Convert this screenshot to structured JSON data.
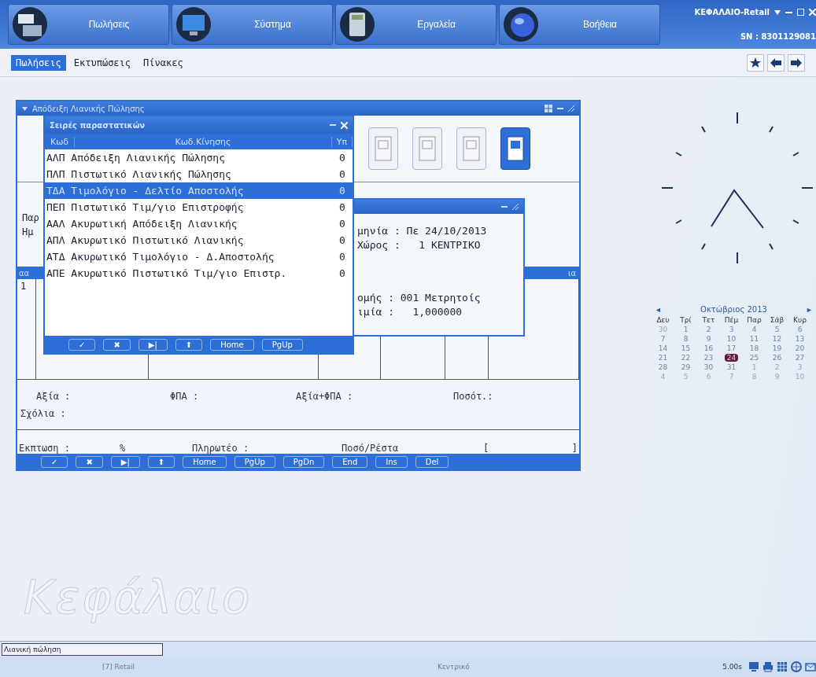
{
  "app_bar": {
    "modules": [
      {
        "label": "Πωλήσεις"
      },
      {
        "label": "Σύστημα"
      },
      {
        "label": "Εργαλεία"
      },
      {
        "label": "Βοήθεια"
      }
    ],
    "title": "ΚΕΦΑΛΑΙΟ-Retail",
    "serial": "SN : 8301129081"
  },
  "menu": [
    {
      "label": "Πωλήσεις",
      "selected": true
    },
    {
      "label": "Εκτυπώσεις",
      "selected": false
    },
    {
      "label": "Πίνακες",
      "selected": false
    }
  ],
  "main_window": {
    "title": "Απόδειξη Λιανικής Πώλησης",
    "doc_buttons": [
      {
        "selected": false
      },
      {
        "selected": false
      },
      {
        "selected": false
      },
      {
        "selected": true
      }
    ],
    "labels": [
      "Παρ",
      "Ημ"
    ],
    "table_header": [
      "αα",
      "ια"
    ],
    "rows": [
      [
        "1"
      ]
    ],
    "totals": [
      "Αξία :",
      "ΦΠΑ :",
      "Αξία+ΦΠΑ :",
      "Ποσότ.:"
    ],
    "comments": "Σχόλια :",
    "payment": [
      "Εκπτωση :",
      "%",
      "Πληρωτέο :",
      "Ποσό/Ρέστα",
      "[",
      "]"
    ],
    "buttons": [
      "✓",
      "✖",
      "▶|",
      "⬆",
      "Home",
      "PgUp",
      "PgDn",
      "End",
      "Ins",
      "Del"
    ]
  },
  "detail_window": {
    "lines_top": [
      "μηνία : Πε 24/10/2013",
      "Χώρος :   1 ΚΕΝΤΡΙΚΟ"
    ],
    "lines_bottom": [
      "ομής : 001 Μετρητοίς",
      "ιμία :   1,000000"
    ]
  },
  "popup": {
    "title": "Σειρές παραστατικών",
    "columns": [
      "Κωδ",
      "Κωδ.Κίνησης",
      "Υπ"
    ],
    "rows": [
      {
        "code": "ΑΛΠ",
        "name": "Απόδειξη Λιανικής Πώλησης",
        "balance": "0",
        "selected": false
      },
      {
        "code": "ΠΛΠ",
        "name": "Πιστωτικό Λιανικής Πώλησης",
        "balance": "0",
        "selected": false
      },
      {
        "code": "ΤΔΑ",
        "name": "Τιμολόγιο - Δελτίο Αποστολής",
        "balance": "0",
        "selected": true
      },
      {
        "code": "ΠΕΠ",
        "name": "Πιστωτικό Τιμ/γιο Επιστροφής",
        "balance": "0",
        "selected": false
      },
      {
        "code": "ΑΑΛ",
        "name": "Ακυρωτική Απόδειξη Λιανικής",
        "balance": "0",
        "selected": false
      },
      {
        "code": "ΑΠΛ",
        "name": "Ακυρωτικό Πιστωτικό Λιανικής",
        "balance": "0",
        "selected": false
      },
      {
        "code": "ΑΤΔ",
        "name": "Ακυρωτικό Τιμολόγιο - Δ.Αποστολής",
        "balance": "0",
        "selected": false
      },
      {
        "code": "ΑΠΕ",
        "name": "Ακυρωτικό Πιστωτικό Τιμ/γιο Επιστρ.",
        "balance": "0",
        "selected": false
      }
    ],
    "buttons": [
      "✓",
      "✖",
      "▶|",
      "⬆",
      "Home",
      "PgUp"
    ]
  },
  "calendar": {
    "prev": "◄",
    "month": "Οκτώβριος 2013",
    "next": "►",
    "weekdays": [
      "Δευ",
      "Τρί",
      "Τετ",
      "Πέμ",
      "Παρ",
      "Σάβ",
      "Κυρ"
    ],
    "weeks": [
      [
        {
          "day": "30",
          "in_month": false,
          "selected": false
        },
        {
          "day": "1",
          "in_month": true,
          "selected": false
        },
        {
          "day": "2",
          "in_month": true,
          "selected": false
        },
        {
          "day": "3",
          "in_month": true,
          "selected": false
        },
        {
          "day": "4",
          "in_month": true,
          "selected": false
        },
        {
          "day": "5",
          "in_month": true,
          "selected": false
        },
        {
          "day": "6",
          "in_month": true,
          "selected": false
        }
      ],
      [
        {
          "day": "7",
          "in_month": true,
          "selected": false
        },
        {
          "day": "8",
          "in_month": true,
          "selected": false
        },
        {
          "day": "9",
          "in_month": true,
          "selected": false
        },
        {
          "day": "10",
          "in_month": true,
          "selected": false
        },
        {
          "day": "11",
          "in_month": true,
          "selected": false
        },
        {
          "day": "12",
          "in_month": true,
          "selected": false
        },
        {
          "day": "13",
          "in_month": true,
          "selected": false
        }
      ],
      [
        {
          "day": "14",
          "in_month": true,
          "selected": false
        },
        {
          "day": "15",
          "in_month": true,
          "selected": false
        },
        {
          "day": "16",
          "in_month": true,
          "selected": false
        },
        {
          "day": "17",
          "in_month": true,
          "selected": false
        },
        {
          "day": "18",
          "in_month": true,
          "selected": false
        },
        {
          "day": "19",
          "in_month": true,
          "selected": false
        },
        {
          "day": "20",
          "in_month": true,
          "selected": false
        }
      ],
      [
        {
          "day": "21",
          "in_month": true,
          "selected": false
        },
        {
          "day": "22",
          "in_month": true,
          "selected": false
        },
        {
          "day": "23",
          "in_month": true,
          "selected": false
        },
        {
          "day": "24",
          "in_month": true,
          "selected": true
        },
        {
          "day": "25",
          "in_month": true,
          "selected": false
        },
        {
          "day": "26",
          "in_month": true,
          "selected": false
        },
        {
          "day": "27",
          "in_month": true,
          "selected": false
        }
      ],
      [
        {
          "day": "28",
          "in_month": true,
          "selected": false
        },
        {
          "day": "29",
          "in_month": true,
          "selected": false
        },
        {
          "day": "30",
          "in_month": true,
          "selected": false
        },
        {
          "day": "31",
          "in_month": true,
          "selected": false
        },
        {
          "day": "1",
          "in_month": false,
          "selected": false
        },
        {
          "day": "2",
          "in_month": false,
          "selected": false
        },
        {
          "day": "3",
          "in_month": false,
          "selected": false
        }
      ],
      [
        {
          "day": "4",
          "in_month": false,
          "selected": false
        },
        {
          "day": "5",
          "in_month": false,
          "selected": false
        },
        {
          "day": "6",
          "in_month": false,
          "selected": false
        },
        {
          "day": "7",
          "in_month": false,
          "selected": false
        },
        {
          "day": "8",
          "in_month": false,
          "selected": false
        },
        {
          "day": "9",
          "in_month": false,
          "selected": false
        },
        {
          "day": "10",
          "in_month": false,
          "selected": false
        }
      ]
    ]
  },
  "logo": "Κεφάλαιο",
  "status": {
    "field": "Λιανική πώληση",
    "items": [
      "[7] Retail",
      "Κεντρικό",
      "5.00s"
    ]
  }
}
